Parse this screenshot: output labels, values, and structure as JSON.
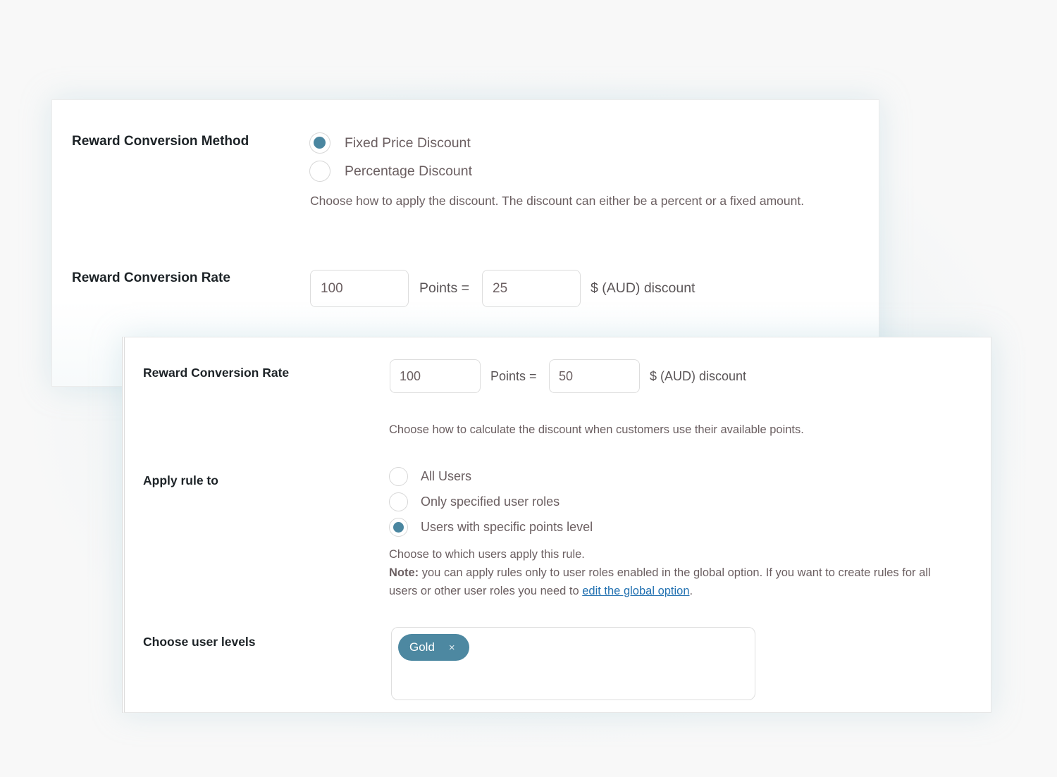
{
  "card1": {
    "method": {
      "label": "Reward Conversion Method",
      "options": [
        {
          "label": "Fixed Price Discount",
          "checked": true
        },
        {
          "label": "Percentage Discount",
          "checked": false
        }
      ],
      "description": "Choose how to apply the discount. The discount can either be a percent or a fixed amount."
    },
    "rate": {
      "label": "Reward Conversion Rate",
      "points_value": "100",
      "points_suffix": "Points =",
      "discount_value": "25",
      "discount_suffix": "$ (AUD) discount"
    }
  },
  "card2": {
    "rate": {
      "label": "Reward Conversion Rate",
      "points_value": "100",
      "points_suffix": "Points =",
      "discount_value": "50",
      "discount_suffix": "$ (AUD) discount",
      "description": "Choose how to calculate the discount when customers use their available points."
    },
    "apply_rule": {
      "label": "Apply rule to",
      "options": [
        {
          "label": "All Users",
          "checked": false
        },
        {
          "label": "Only specified user roles",
          "checked": false
        },
        {
          "label": "Users with specific points level",
          "checked": true
        }
      ],
      "description": "Choose to which users apply this rule.",
      "note_bold": "Note:",
      "note_text": " you can apply rules only to user roles enabled in the global option. If you want to create rules for all",
      "note_text_line2": "users or other user roles you need to ",
      "note_link": "edit the global option",
      "note_end": "."
    },
    "user_levels": {
      "label": "Choose user levels",
      "selected": [
        {
          "label": "Gold",
          "remove_icon": "×"
        }
      ]
    }
  },
  "colors": {
    "accent": "#4a86a0",
    "link": "#2271b1",
    "label_text": "#1d2327",
    "description_text": "#6b5f61",
    "background": "#f8f8f8"
  }
}
